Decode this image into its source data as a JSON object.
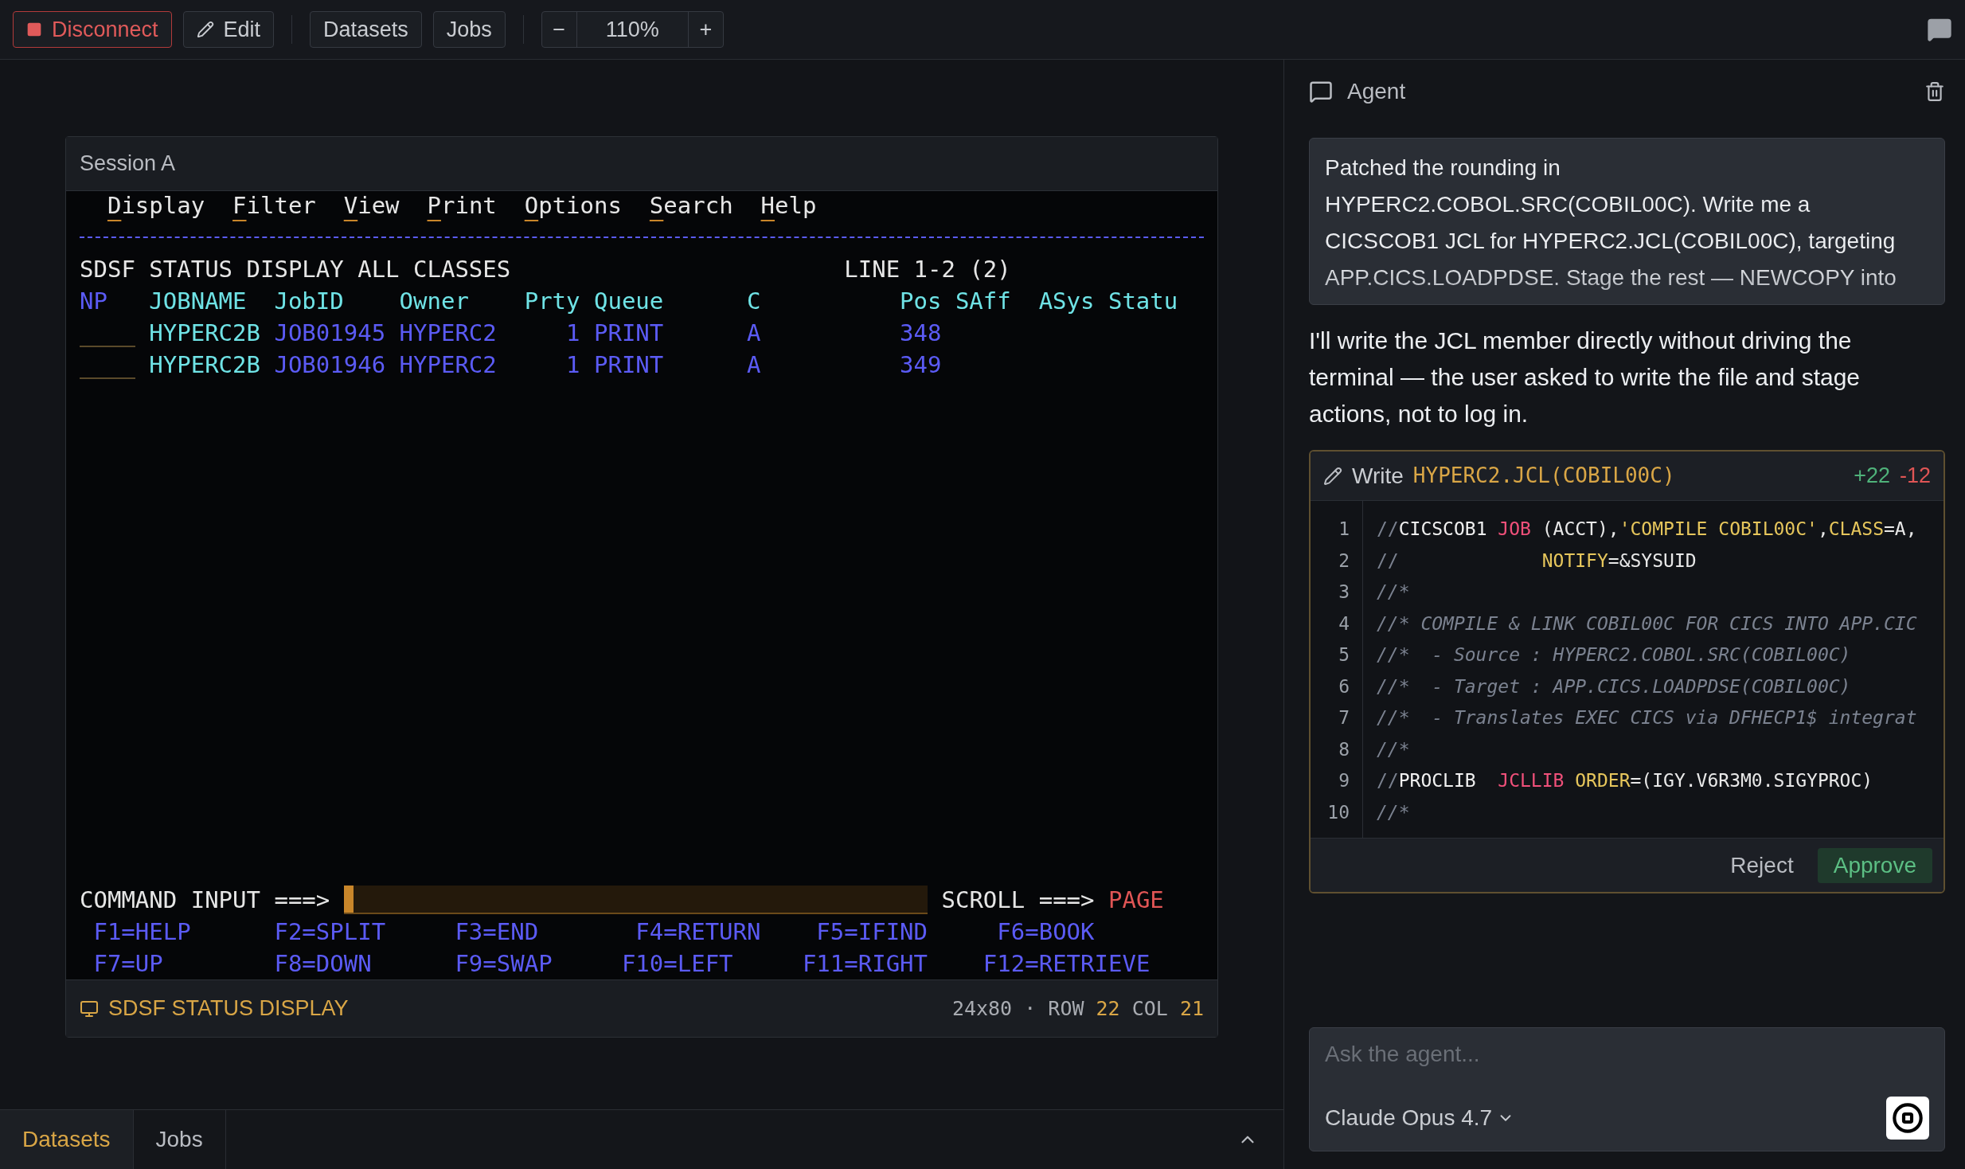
{
  "toolbar": {
    "buttons": [
      {
        "label": "Disconnect",
        "kind": "danger"
      },
      {
        "label": "Edit",
        "kind": "edit"
      },
      {
        "label": "Datasets",
        "kind": "plain"
      },
      {
        "label": "Jobs",
        "kind": "plain"
      }
    ],
    "zoom": {
      "minus": "−",
      "value": "110%",
      "plus": "+"
    }
  },
  "terminal": {
    "title": "Session A",
    "menu": [
      "Display",
      "Filter",
      "View",
      "Print",
      "Options",
      "Search",
      "Help"
    ],
    "header": {
      "title": "SDSF STATUS DISPLAY ALL CLASSES",
      "lines": "LINE 1-2 (2)"
    },
    "columns": [
      {
        "label": "NP",
        "color": "#5b5bf5"
      },
      {
        "label": "JOBNAME",
        "color": "#6fe3e6"
      },
      {
        "label": "JobID",
        "color": "#6fe3e6"
      },
      {
        "label": "Owner",
        "color": "#6fe3e6"
      },
      {
        "label": "Prty",
        "color": "#6fe3e6"
      },
      {
        "label": "Queue",
        "color": "#6fe3e6"
      },
      {
        "label": "C",
        "color": "#6fe3e6"
      },
      {
        "label": "Pos",
        "color": "#6fe3e6"
      },
      {
        "label": "SAff",
        "color": "#6fe3e6"
      },
      {
        "label": "ASys",
        "color": "#6fe3e6"
      },
      {
        "label": "Statu",
        "color": "#6fe3e6"
      }
    ],
    "rows": [
      {
        "cells": [
          {
            "kind": "input"
          },
          {
            "text": "HYPERC2B",
            "color": "#6fe3e6"
          },
          {
            "text": "JOB01945",
            "color": "#5b5bf5"
          },
          {
            "text": "HYPERC2",
            "color": "#5b5bf5"
          },
          {
            "text": "1",
            "color": "#5b5bf5"
          },
          {
            "text": "PRINT",
            "color": "#5b5bf5"
          },
          {
            "text": "A",
            "color": "#5b5bf5"
          },
          {
            "text": "348",
            "color": "#5b5bf5"
          }
        ]
      },
      {
        "cells": [
          {
            "kind": "input"
          },
          {
            "text": "HYPERC2B",
            "color": "#6fe3e6"
          },
          {
            "text": "JOB01946",
            "color": "#5b5bf5"
          },
          {
            "text": "HYPERC2",
            "color": "#5b5bf5"
          },
          {
            "text": "1",
            "color": "#5b5bf5"
          },
          {
            "text": "PRINT",
            "color": "#5b5bf5"
          },
          {
            "text": "A",
            "color": "#5b5bf5"
          },
          {
            "text": "349",
            "color": "#5b5bf5"
          }
        ]
      }
    ],
    "command": {
      "label": "COMMAND INPUT ===>",
      "scroll_label": "SCROLL ===>",
      "scroll_value": "PAGE"
    },
    "function_keys": [
      [
        "F1=HELP",
        "F2=SPLIT",
        "F3=END",
        "F4=RETURN",
        "F5=IFIND",
        "F6=BOOK"
      ],
      [
        "F7=UP",
        "F8=DOWN",
        "F9=SWAP",
        "F10=LEFT",
        "F11=RIGHT",
        "F12=RETRIEVE"
      ]
    ],
    "status": {
      "title": "SDSF STATUS DISPLAY",
      "size": "24x80",
      "separator": "·",
      "row_label": "ROW",
      "row": "22",
      "col_label": "COL",
      "col": "21"
    }
  },
  "bottom_tabs": [
    {
      "label": "Datasets",
      "selected": true
    },
    {
      "label": "Jobs",
      "selected": false
    }
  ],
  "agent": {
    "title": "Agent",
    "messages": [
      {
        "kind": "user",
        "text": "Patched the rounding in HYPERC2.COBOL.SRC(COBIL00C). Write me a CICSCOB1 JCL for HYPERC2.JCL(COBIL00C), targeting APP.CICS.LOADPDSE. Stage the rest — NEWCOPY into"
      },
      {
        "kind": "assistant",
        "text": "I'll write the JCL member directly without driving the terminal — the user asked to write the file and stage actions, not to log in."
      },
      {
        "kind": "tool",
        "action": "Write",
        "target": "HYPERC2.JCL(COBIL00C)",
        "added": "+22",
        "removed": "-12",
        "lines": [
          {
            "number": "1",
            "tokens": [
              {
                "t": "//",
                "kind": "slash"
              },
              {
                "t": "CICSCOB1 ",
                "kind": "name"
              },
              {
                "t": "JOB",
                "kind": "keyword"
              },
              {
                "t": " (ACCT),",
                "kind": "plain"
              },
              {
                "t": "'COMPILE COBIL00C'",
                "kind": "string"
              },
              {
                "t": ",",
                "kind": "plain"
              },
              {
                "t": "CLASS",
                "kind": "param"
              },
              {
                "t": "=A,",
                "kind": "plain"
              }
            ]
          },
          {
            "number": "2",
            "tokens": [
              {
                "t": "//             ",
                "kind": "slash"
              },
              {
                "t": "NOTIFY",
                "kind": "param"
              },
              {
                "t": "=&SYSUID",
                "kind": "plain"
              }
            ]
          },
          {
            "number": "3",
            "tokens": [
              {
                "t": "//*",
                "kind": "comment"
              }
            ]
          },
          {
            "number": "4",
            "tokens": [
              {
                "t": "//* COMPILE & LINK COBIL00C FOR CICS INTO APP.CIC",
                "kind": "comment"
              }
            ]
          },
          {
            "number": "5",
            "tokens": [
              {
                "t": "//*  - Source : HYPERC2.COBOL.SRC(COBIL00C)",
                "kind": "comment"
              }
            ]
          },
          {
            "number": "6",
            "tokens": [
              {
                "t": "//*  - Target : APP.CICS.LOADPDSE(COBIL00C)",
                "kind": "comment"
              }
            ]
          },
          {
            "number": "7",
            "tokens": [
              {
                "t": "//*  - Translates EXEC CICS via DFHECP1$ integrat",
                "kind": "comment"
              }
            ]
          },
          {
            "number": "8",
            "tokens": [
              {
                "t": "//*",
                "kind": "comment"
              }
            ]
          },
          {
            "number": "9",
            "tokens": [
              {
                "t": "//",
                "kind": "slash"
              },
              {
                "t": "PROCLIB  ",
                "kind": "name"
              },
              {
                "t": "JCLLIB ",
                "kind": "keyword"
              },
              {
                "t": "ORDER",
                "kind": "param"
              },
              {
                "t": "=(IGY.V6R3M0.SIGYPROC)",
                "kind": "plain"
              }
            ]
          },
          {
            "number": "10",
            "tokens": [
              {
                "t": "//*",
                "kind": "comment"
              }
            ]
          }
        ],
        "buttons": [
          {
            "label": "Reject",
            "kind": "secondary"
          },
          {
            "label": "Approve",
            "kind": "primary"
          }
        ]
      }
    ],
    "input": {
      "placeholder": "Ask the agent...",
      "model": "Claude Opus 4.7"
    }
  }
}
